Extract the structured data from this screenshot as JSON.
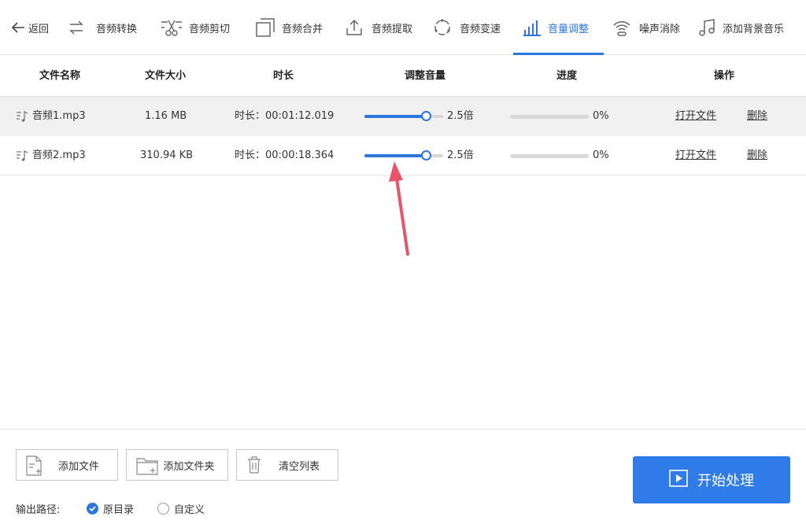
{
  "toolbar": {
    "back": "返回",
    "items": [
      {
        "label": "音频转换",
        "icon": "convert-icon"
      },
      {
        "label": "音频剪切",
        "icon": "scissors-icon"
      },
      {
        "label": "音频合并",
        "icon": "merge-icon"
      },
      {
        "label": "音频提取",
        "icon": "upload-icon"
      },
      {
        "label": "音频变速",
        "icon": "speed-icon"
      },
      {
        "label": "音量调整",
        "icon": "volume-bars-icon",
        "active": true
      },
      {
        "label": "噪声消除",
        "icon": "noise-icon"
      },
      {
        "label": "添加背景音乐",
        "icon": "music-note-icon"
      }
    ]
  },
  "table": {
    "headers": [
      "文件名称",
      "文件大小",
      "时长",
      "调整音量",
      "进度",
      "操作"
    ],
    "rows": [
      {
        "name": "音频1.mp3",
        "size": "1.16 MB",
        "duration": "时长：00:01:12.019",
        "volume": 0.78,
        "volume_label": "2.5倍",
        "progress": "0%",
        "open": "打开文件",
        "delete": "删除"
      },
      {
        "name": "音频2.mp3",
        "size": "310.94 KB",
        "duration": "时长：00:00:18.364",
        "volume": 0.78,
        "volume_label": "2.5倍",
        "progress": "0%",
        "open": "打开文件",
        "delete": "删除"
      }
    ]
  },
  "buttons": {
    "add_file": "添加文件",
    "add_folder": "添加文件夹",
    "clear_list": "清空列表",
    "start": "开始处理"
  },
  "output": {
    "label": "输出路径:",
    "options": [
      "原目录",
      "自定义"
    ],
    "selected": "原目录"
  },
  "colors": {
    "accent": "#2e75e0",
    "annotation": "#e8546b"
  }
}
